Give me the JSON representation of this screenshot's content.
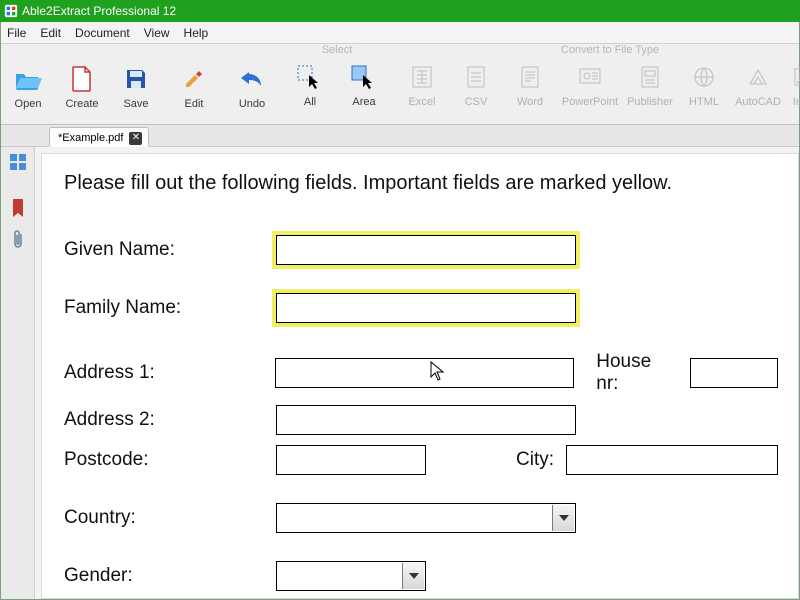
{
  "app": {
    "title": "Able2Extract Professional 12"
  },
  "menu": {
    "file": "File",
    "edit": "Edit",
    "document": "Document",
    "view": "View",
    "help": "Help"
  },
  "toolbar": {
    "open": "Open",
    "create": "Create",
    "save": "Save",
    "edit": "Edit",
    "undo": "Undo",
    "select_group": "Select",
    "all": "All",
    "area": "Area",
    "convert_group": "Convert to File Type",
    "excel": "Excel",
    "csv": "CSV",
    "word": "Word",
    "powerpoint": "PowerPoint",
    "publisher": "Publisher",
    "html": "HTML",
    "autocad": "AutoCAD",
    "image": "Imag"
  },
  "tab": {
    "name": "*Example.pdf"
  },
  "doc": {
    "instruction": "Please fill out the following fields. Important fields are marked yellow.",
    "labels": {
      "given_name": "Given Name:",
      "family_name": "Family Name:",
      "address1": "Address 1:",
      "address2": "Address 2:",
      "house_nr": "House nr:",
      "postcode": "Postcode:",
      "city": "City:",
      "country": "Country:",
      "gender": "Gender:"
    }
  },
  "icons": {
    "thumbnails": "thumbnails-icon",
    "bookmark": "bookmark-icon",
    "attachment": "attachment-icon"
  }
}
